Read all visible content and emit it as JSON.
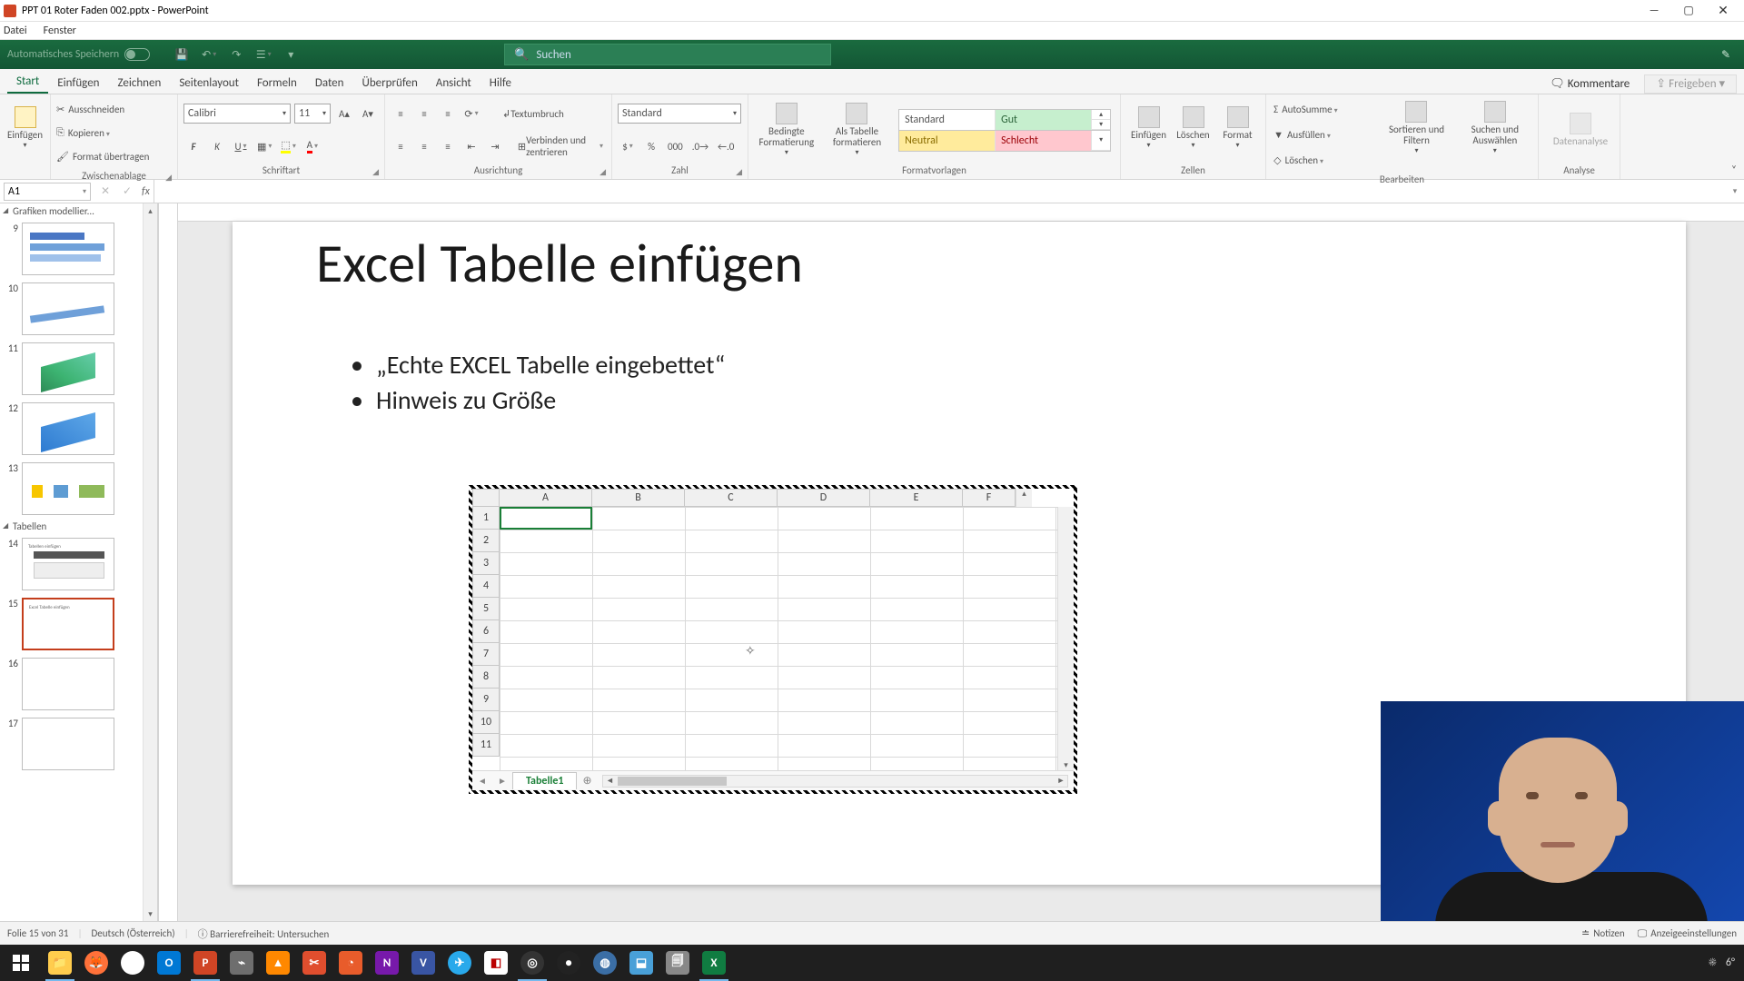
{
  "title": "PPT 01 Roter Faden 002.pptx - PowerPoint",
  "menubar": {
    "datei": "Datei",
    "fenster": "Fenster"
  },
  "qat": {
    "autosave": "Automatisches Speichern",
    "search_placeholder": "Suchen"
  },
  "tabs": {
    "start": "Start",
    "einfuegen": "Einfügen",
    "zeichnen": "Zeichnen",
    "seitenlayout": "Seitenlayout",
    "formeln": "Formeln",
    "daten": "Daten",
    "ueberpruefen": "Überprüfen",
    "ansicht": "Ansicht",
    "hilfe": "Hilfe",
    "kommentare": "Kommentare",
    "freigeben": "Freigeben"
  },
  "ribbon": {
    "einfuegen_big": "Einfügen",
    "ausschneiden": "Ausschneiden",
    "kopieren": "Kopieren",
    "formatuebertragen": "Format übertragen",
    "zwischenablage": "Zwischenablage",
    "font_name": "Calibri",
    "font_size": "11",
    "schriftart": "Schriftart",
    "textumbruch": "Textumbruch",
    "verbinden": "Verbinden und zentrieren",
    "ausrichtung": "Ausrichtung",
    "numfmt": "Standard",
    "zahl": "Zahl",
    "bedingte": "Bedingte Formatierung",
    "alstabelle": "Als Tabelle formatieren",
    "style_standard": "Standard",
    "style_gut": "Gut",
    "style_neutral": "Neutral",
    "style_schlecht": "Schlecht",
    "formatvorlagen": "Formatvorlagen",
    "zeinfuegen": "Einfügen",
    "loeschen": "Löschen",
    "format": "Format",
    "zellen": "Zellen",
    "autosumme": "AutoSumme",
    "ausfuellen": "Ausfüllen",
    "loeschen2": "Löschen",
    "sortieren": "Sortieren und Filtern",
    "suchen": "Suchen und Auswählen",
    "bearbeiten": "Bearbeiten",
    "datenanalyse": "Datenanalyse",
    "analyse": "Analyse"
  },
  "fbar": {
    "namebox": "A1",
    "fx": "fx"
  },
  "thumbs": {
    "section1": "Grafiken modellier...",
    "section2": "Tabellen",
    "n9": "9",
    "n10": "10",
    "n11": "11",
    "n12": "12",
    "n13": "13",
    "n14": "14",
    "n15": "15",
    "n16": "16",
    "n17": "17"
  },
  "slide": {
    "title": "Excel Tabelle einfügen",
    "b1": "„Echte EXCEL Tabelle eingebettet“",
    "b2": "Hinweis zu Größe"
  },
  "excel": {
    "cols": [
      "A",
      "B",
      "C",
      "D",
      "E",
      "F"
    ],
    "rows": [
      "1",
      "2",
      "3",
      "4",
      "5",
      "6",
      "7",
      "8",
      "9",
      "10",
      "11"
    ],
    "sheet": "Tabelle1"
  },
  "status": {
    "folie": "Folie 15 von 31",
    "lang": "Deutsch (Österreich)",
    "access": "Barrierefreiheit: Untersuchen",
    "notizen": "Notizen",
    "anzeige": "Anzeigeeinstellungen"
  },
  "taskbar": {
    "temp": "6°"
  }
}
